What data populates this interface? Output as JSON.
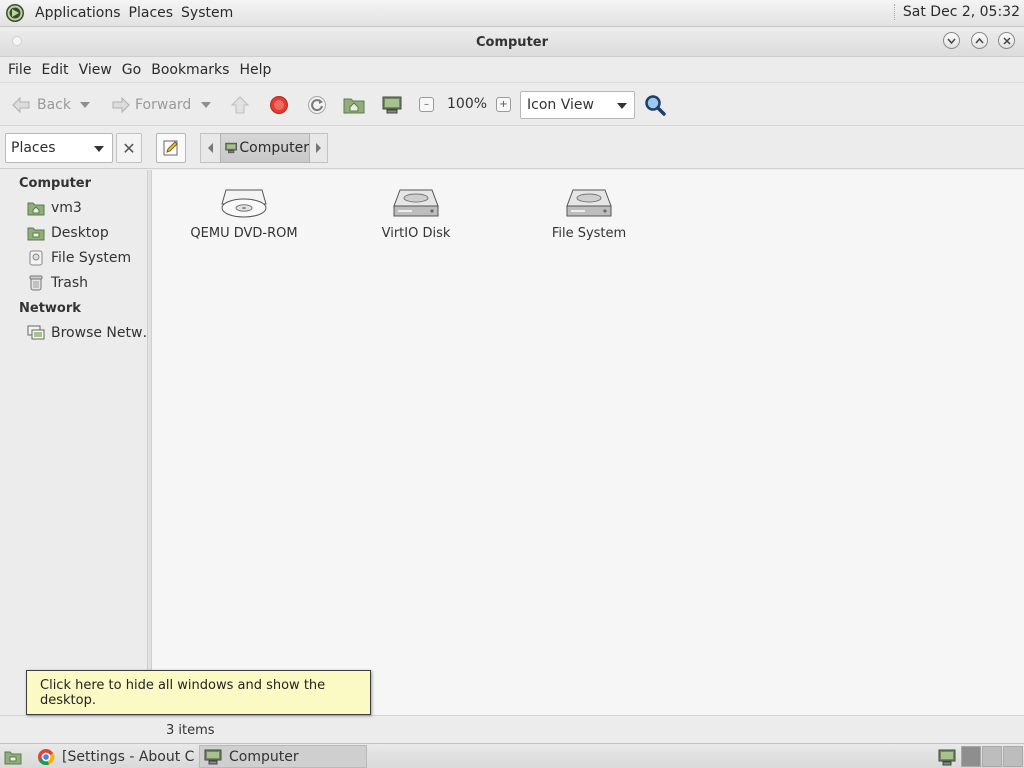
{
  "top_panel": {
    "menus": [
      "Applications",
      "Places",
      "System"
    ],
    "clock": "Sat Dec  2, 05:32"
  },
  "window": {
    "title": "Computer"
  },
  "menubar": [
    "File",
    "Edit",
    "View",
    "Go",
    "Bookmarks",
    "Help"
  ],
  "toolbar": {
    "back_label": "Back",
    "forward_label": "Forward",
    "zoom_level": "100%",
    "view_mode": "Icon View"
  },
  "locationbar": {
    "side_pane_mode": "Places",
    "path_current": "Computer"
  },
  "sidebar": {
    "section_computer": "Computer",
    "computer_items": [
      {
        "label": "vm3",
        "icon": "home-folder-icon"
      },
      {
        "label": "Desktop",
        "icon": "desktop-folder-icon"
      },
      {
        "label": "File System",
        "icon": "filesystem-icon"
      },
      {
        "label": "Trash",
        "icon": "trash-icon"
      }
    ],
    "section_network": "Network",
    "network_items": [
      {
        "label": "Browse Netw…",
        "icon": "network-icon"
      }
    ]
  },
  "content": {
    "items": [
      {
        "label": "QEMU DVD-ROM",
        "icon": "optical-drive-icon"
      },
      {
        "label": "VirtIO Disk",
        "icon": "harddisk-icon"
      },
      {
        "label": "File System",
        "icon": "harddisk-icon"
      }
    ]
  },
  "statusbar": {
    "text": "3 items"
  },
  "tooltip": {
    "text": "Click here to hide all windows and show the desktop."
  },
  "taskbar": {
    "tasks": [
      {
        "label": "[Settings - About C…",
        "icon": "chrome-icon"
      },
      {
        "label": "Computer",
        "icon": "computer-icon"
      }
    ]
  },
  "colors": {
    "window_bg": "#ececec",
    "content_bg": "#f6f6f6",
    "tooltip_bg": "#fbfac5",
    "stop_red": "#e03c31",
    "folder_green": "#8fae7a"
  }
}
